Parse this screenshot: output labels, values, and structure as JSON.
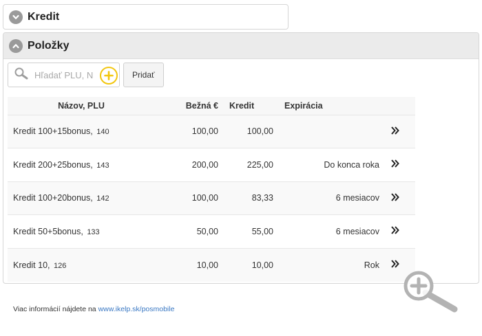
{
  "panels": {
    "credit": {
      "title": "Kredit",
      "state": "collapsed"
    },
    "items": {
      "title": "Položky",
      "state": "expanded"
    }
  },
  "search": {
    "placeholder": "Hľadať PLU, N",
    "value": ""
  },
  "toolbar": {
    "add_label": "Pridať"
  },
  "table": {
    "headers": {
      "name": "Názov, PLU",
      "price": "Bežná €",
      "credit": "Kredit",
      "expiry": "Expirácia"
    },
    "rows": [
      {
        "name": "Kredit 100+15bonus,",
        "plu": "140",
        "price": "100,00",
        "credit": "100,00",
        "expiry": ""
      },
      {
        "name": "Kredit 200+25bonus,",
        "plu": "143",
        "price": "200,00",
        "credit": "225,00",
        "expiry": "Do konca roka"
      },
      {
        "name": "Kredit 100+20bonus,",
        "plu": "142",
        "price": "100,00",
        "credit": "83,33",
        "expiry": "6 mesiacov"
      },
      {
        "name": "Kredit 50+5bonus,",
        "plu": "133",
        "price": "50,00",
        "credit": "55,00",
        "expiry": "6 mesiacov"
      },
      {
        "name": "Kredit 10,",
        "plu": "126",
        "price": "10,00",
        "credit": "10,00",
        "expiry": "Rok"
      }
    ]
  },
  "footer": {
    "text": "Viac informácií nájdete na",
    "link_text": "www.ikelp.sk/posmobile"
  },
  "icons": {
    "chevron_collapsed": "chevron-down-icon",
    "chevron_expanded": "chevron-up-icon",
    "search": "search-icon",
    "add": "plus-circle-icon",
    "row_action": "double-chevron-right-icon",
    "zoom": "zoom-in-icon"
  },
  "colors": {
    "accent_yellow": "#f2c60f",
    "link": "#3a78c3",
    "header_bg": "#ebebeb",
    "chevron_bg": "#9a9a9a"
  }
}
